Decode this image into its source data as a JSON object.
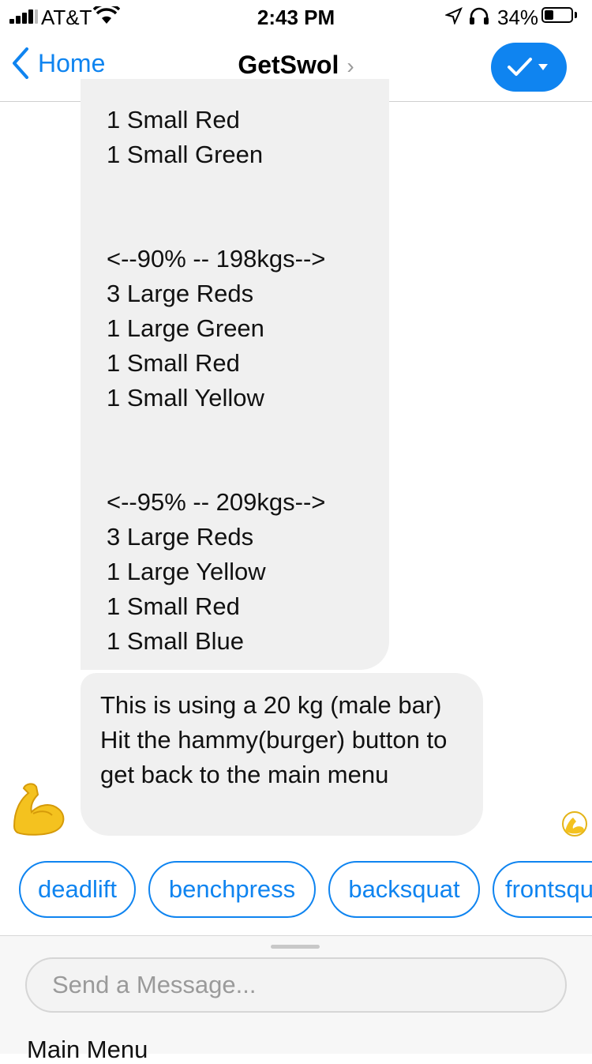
{
  "status_bar": {
    "carrier": "AT&T",
    "time": "2:43 PM",
    "battery": "34%",
    "battery_level": 0.34
  },
  "nav": {
    "back_label": "Home",
    "title": "GetSwol",
    "title_chevron": "›",
    "done_icon": "checkmark-icon"
  },
  "messages": [
    {
      "lines": [
        "1 Small Red",
        "1 Small Green",
        "",
        "<--90% -- 198kgs-->",
        "3 Large Reds",
        "1 Large Green",
        "1 Small Red",
        "1 Small Yellow",
        "",
        "<--95% -- 209kgs-->",
        "3 Large Reds",
        "1 Large Yellow",
        "1 Small Red",
        "1 Small Blue"
      ]
    },
    {
      "text": "This is using a 20 kg (male bar) Hit the hammy(burger) button to get back to the main menu"
    }
  ],
  "quick_replies": [
    "deadlift",
    "benchpress",
    "backsquat",
    "frontsquat"
  ],
  "composer": {
    "placeholder": "Send a Message...",
    "menu_label": "Main Menu"
  },
  "colors": {
    "accent": "#0f84f0",
    "bubble": "#f0f0f0"
  }
}
